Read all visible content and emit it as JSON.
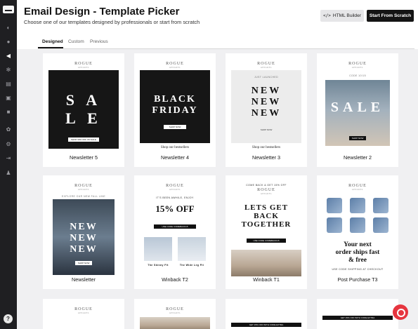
{
  "app": {
    "title": "Email Design - Template Picker",
    "subtitle": "Choose one of our templates designed by professionals or start from scratch"
  },
  "toolbar": {
    "html_builder_label": "HTML Builder",
    "html_builder_icon": "</>",
    "start_scratch_label": "Start From Scratch"
  },
  "tabs": [
    {
      "label": "Designed",
      "active": true
    },
    {
      "label": "Custom"
    },
    {
      "label": "Previous"
    }
  ],
  "sidebar": {
    "icons": [
      "dashboard-icon",
      "contacts-icon",
      "campaigns-icon",
      "automation-icon",
      "reports-icon",
      "pages-icon",
      "forms-icon",
      "integrations-icon",
      "settings-icon",
      "logout-icon",
      "account-icon"
    ],
    "help_label": "?"
  },
  "brand": {
    "name": "ROGUE",
    "tag": "APPAREL"
  },
  "templates": [
    {
      "label": "Newsletter 5",
      "heading": "SA LE",
      "heading_l1": "S A",
      "heading_l2": "L E",
      "cta": "SHOP 30% OFF ON SALE"
    },
    {
      "label": "Newsletter 4",
      "heading_l1": "BLACK",
      "heading_l2": "FRIDAY",
      "cta": "SHOP NOW",
      "footer": "Shop our bestsellers"
    },
    {
      "label": "Newsletter 3",
      "kicker": "JUST LAUNCHED",
      "heading_l1": "NEW",
      "heading_l2": "NEW",
      "heading_l3": "NEW",
      "cta": "SHOP NOW",
      "footer": "Shop our bestsellers"
    },
    {
      "label": "Newsletter 2",
      "kicker": "CODE 10/15",
      "heading": "SALE",
      "cta": "SHOP NOW"
    },
    {
      "label": "Newsletter",
      "kicker": "EXPLORE OUR NEW FALL LINE",
      "heading_l1": "NEW",
      "heading_l2": "NEW",
      "heading_l3": "NEW",
      "cta": "SHOP NOW"
    },
    {
      "label": "Winback T2",
      "kicker": "IT'S BEEN AWHILE, ENJOY",
      "heading": "15% OFF",
      "cta": "USE CODE COMEBACK15",
      "item1": "The Skinny Fit",
      "item2": "The Wide Leg Fit"
    },
    {
      "label": "Winback T1",
      "kicker": "COME BACK & GET 15% OFF",
      "heading_l1": "LETS GET",
      "heading_l2": "BACK",
      "heading_l3": "TOGETHER",
      "cta": "USE CODE COMEBACK15"
    },
    {
      "label": "Post Purchase T3",
      "heading_l1": "Your next",
      "heading_l2": "order ships fast",
      "heading_l3": "& free",
      "cta": "USE CODE SHIPPING AT CHECKOUT"
    }
  ],
  "row3": [
    {
      "bar": ""
    },
    {
      "bar": ""
    },
    {
      "bar": "GET 15% OFF WITH CODE EXTRA"
    },
    {
      "bar": "GET 15% OFF WITH CODE EXTRA"
    }
  ]
}
